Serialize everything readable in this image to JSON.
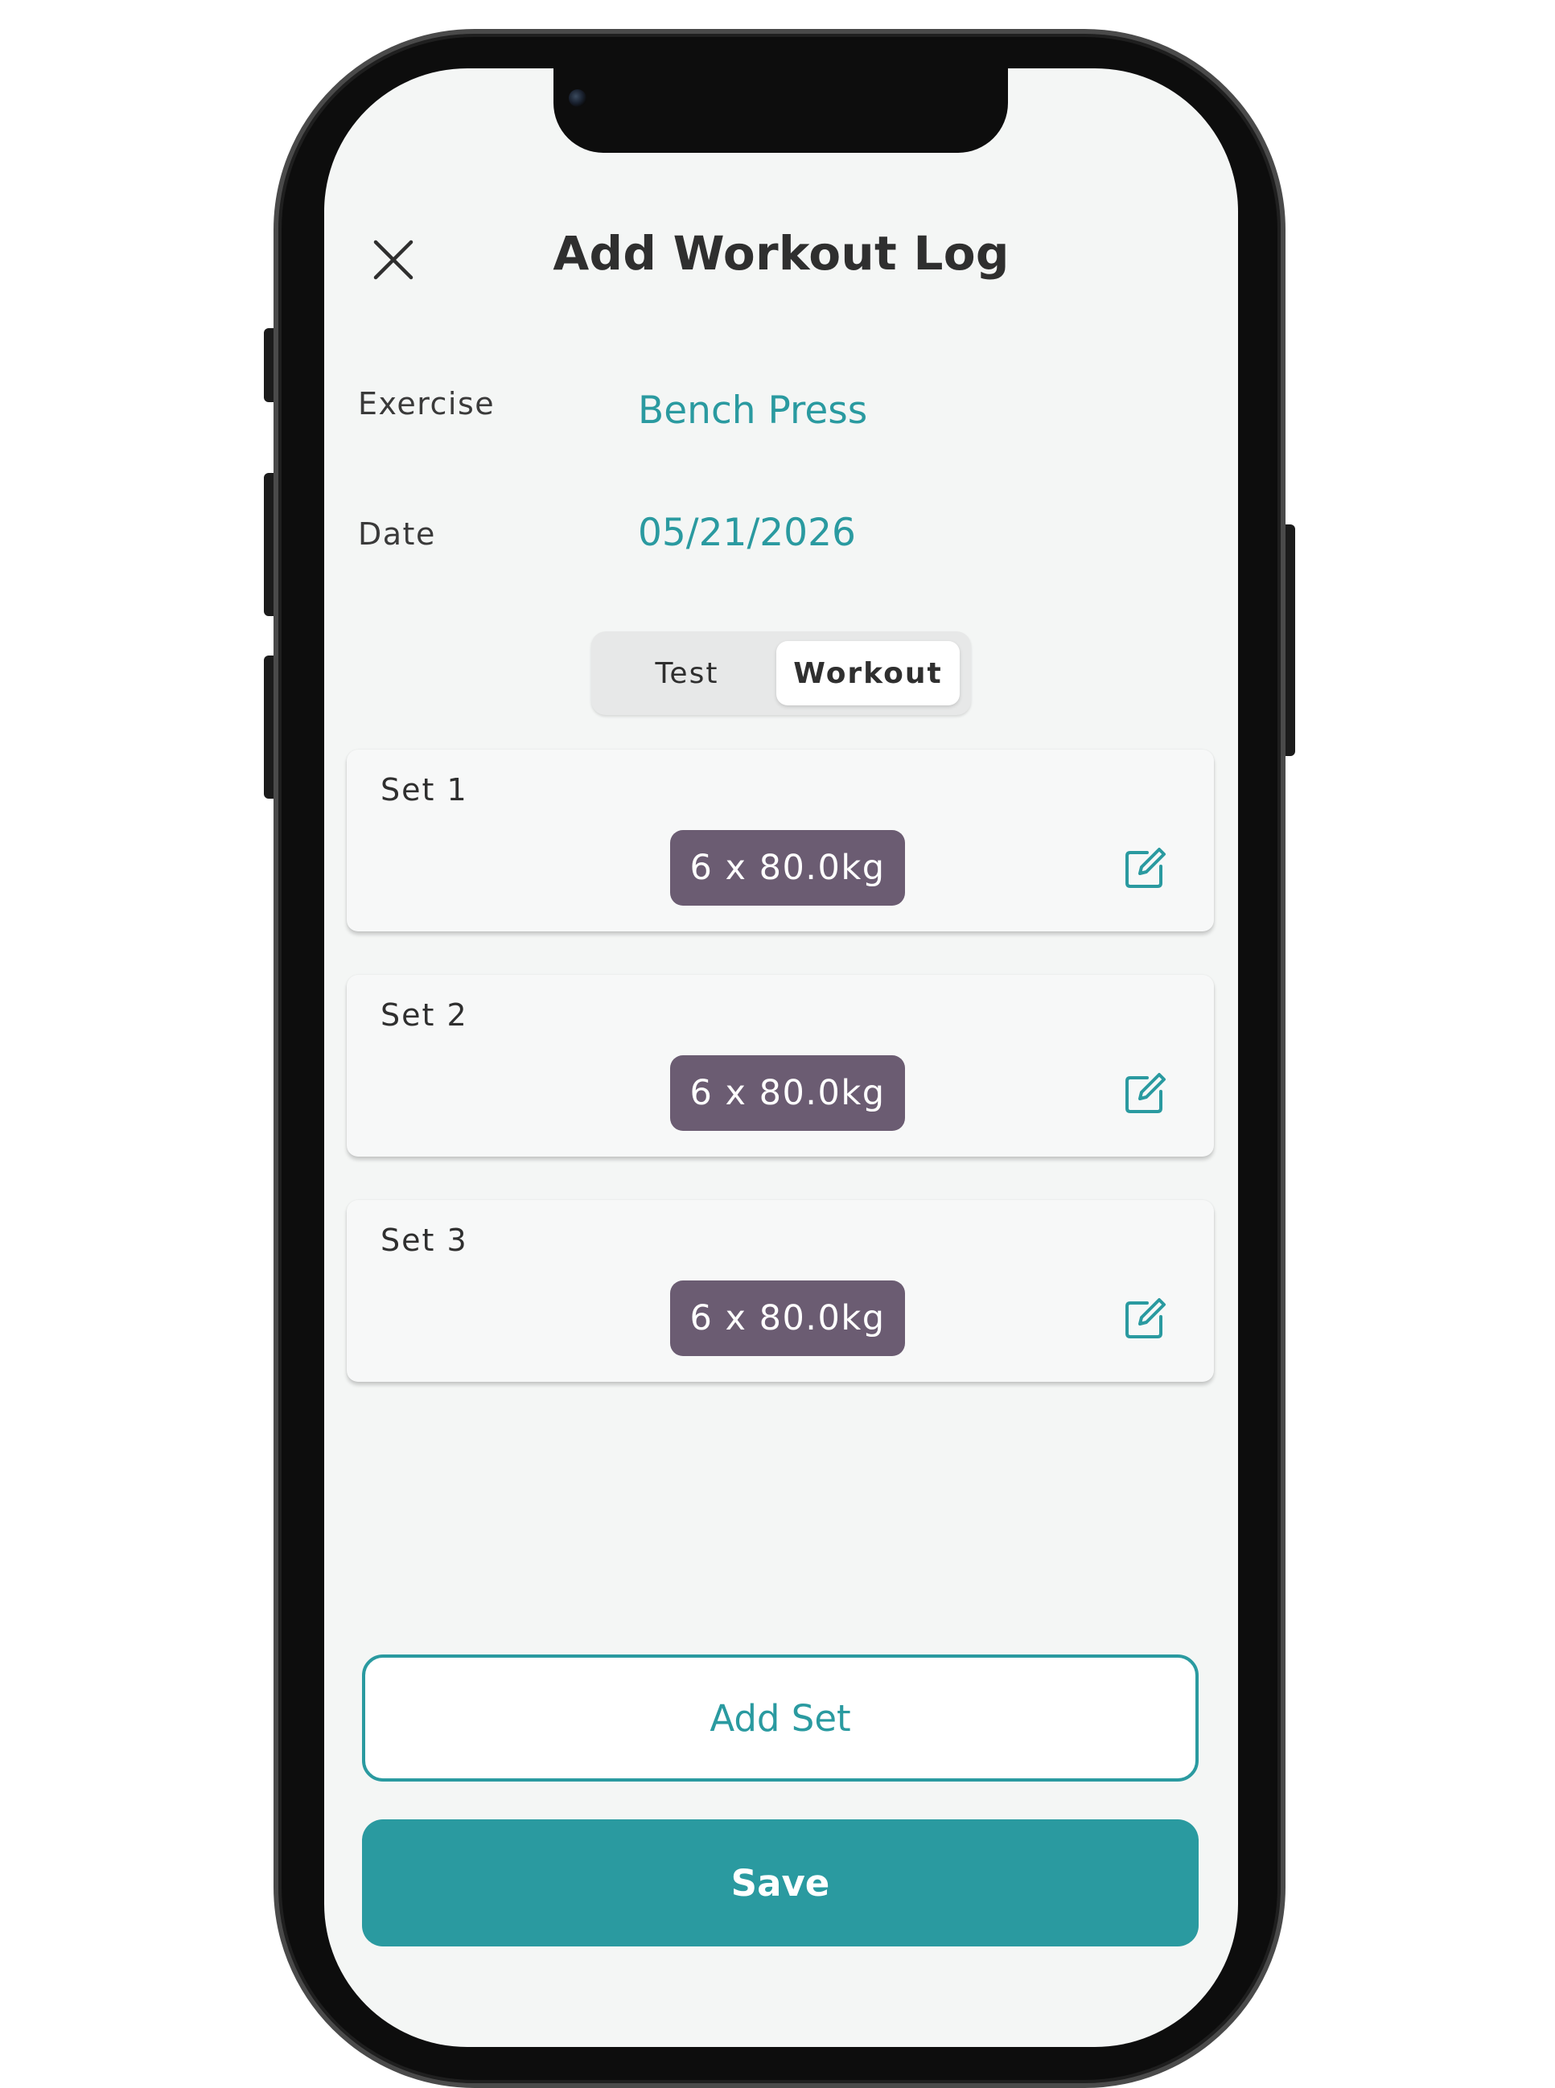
{
  "header": {
    "title": "Add Workout Log",
    "close_icon": "close-icon"
  },
  "form": {
    "exercise_label": "Exercise",
    "exercise_value": "Bench Press",
    "date_label": "Date",
    "date_value": "05/21/2026"
  },
  "mode_toggle": {
    "options": [
      "Test",
      "Workout"
    ],
    "selected": "Workout"
  },
  "sets": [
    {
      "label": "Set 1",
      "value": "6 x 80.0kg"
    },
    {
      "label": "Set 2",
      "value": "6 x 80.0kg"
    },
    {
      "label": "Set 3",
      "value": "6 x 80.0kg"
    }
  ],
  "actions": {
    "add_set_label": "Add Set",
    "save_label": "Save"
  },
  "icons": {
    "edit": "edit-icon",
    "close": "close-icon"
  },
  "colors": {
    "accent": "#2a9aa0",
    "chip": "#6b5c72",
    "screen_bg": "#f4f6f5",
    "title_text": "#2f2f2f"
  }
}
